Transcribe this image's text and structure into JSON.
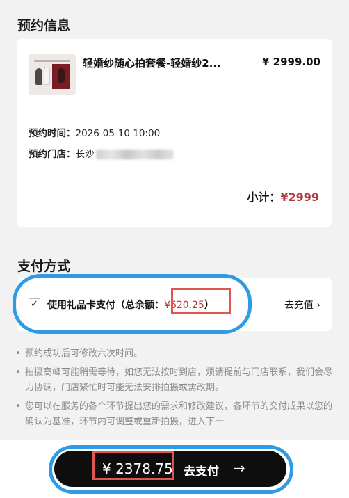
{
  "booking": {
    "section_title": "预约信息",
    "package_title": "轻婚纱随心拍套餐-轻婚纱2...",
    "package_price": "¥ 2999.00",
    "time_label": "预约时间：",
    "time_value": "2026-05-10 10:00",
    "store_label": "预约门店：",
    "store_value": "长沙",
    "subtotal_label": "小计：",
    "subtotal_value": "¥2999"
  },
  "payment": {
    "section_title": "支付方式",
    "checkbox_mark": "✓",
    "gift_card_label": "使用礼品卡支付（总余额：",
    "gift_card_balance": "¥620.25",
    "gift_card_close": "）",
    "recharge_label": "去充值",
    "recharge_chevron": "›"
  },
  "notes": [
    {
      "bullet": "•",
      "text": "预约成功后可修改六次时间。"
    },
    {
      "bullet": "•",
      "text": "拍摄高峰可能稍需等待，如您无法按时到店，烦请提前与门店联系，我们会尽力协调，门店繁忙时可能无法安排拍摄或需改期。"
    },
    {
      "bullet": "•",
      "text": "您可以在服务的各个环节提出您的需求和修改建议，各环节的交付成果以您的确认为基准，环节内可调整或重新拍摄，进入下一"
    }
  ],
  "checkout": {
    "total": "¥ 2378.75",
    "pay_label": "去支付",
    "arrow": "→"
  },
  "colors": {
    "accent_red": "#b23a48",
    "highlight_box": "#e0554e",
    "annotation_blue": "#2f9be6",
    "button_black": "#0e0e0e"
  }
}
